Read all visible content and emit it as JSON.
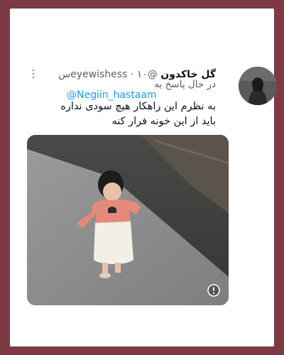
{
  "tweet": {
    "display_name": "گل خاکدون",
    "handle": "@eyewishess",
    "separator": "·",
    "time": "۱۰س",
    "reply_prefix": "در حال پاسخ به",
    "reply_to": "@Negiin_hastaam",
    "text_line1": "به نظرم این راهکار هیچ سودی نداره",
    "text_line2": "باید از این خونه فرار کنه"
  },
  "icons": {
    "more": "more-vertical-icon",
    "media_alert": "alert-circle-icon"
  },
  "colors": {
    "background": "#7d3a45",
    "card": "#ffffff",
    "link": "#1d9bf0",
    "muted": "#536471",
    "text": "#0f1419"
  }
}
